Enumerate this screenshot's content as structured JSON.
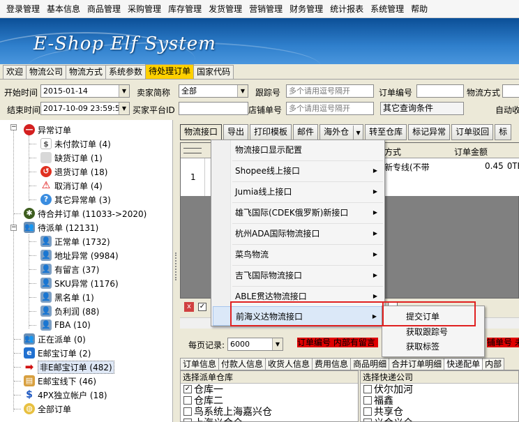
{
  "menubar": [
    "登录管理",
    "基本信息",
    "商品管理",
    "采购管理",
    "库存管理",
    "发货管理",
    "营销管理",
    "财务管理",
    "统计报表",
    "系统管理",
    "帮助"
  ],
  "banner": {
    "title": "E-Shop Elf System"
  },
  "tabs": [
    "欢迎",
    "物流公司",
    "物流方式",
    "系统参数",
    "待处理订单",
    "国家代码"
  ],
  "filters": {
    "start_label": "开始时间",
    "start_value": "2015-01-14",
    "end_label": "结束时间",
    "end_value": "2017-10-09 23:59:5",
    "seller_label": "卖家简称",
    "seller_value": "全部",
    "buyer_label": "买家平台ID",
    "track_label": "跟踪号",
    "track_placeholder": "多个请用逗号隔开",
    "shop_label": "店铺单号",
    "shop_placeholder": "多个请用逗号隔开",
    "order_label": "订单编号",
    "other_label": "其它查询条件",
    "ship_label": "物流方式",
    "auto_label": "自动收"
  },
  "tree": [
    {
      "label": "异常订单",
      "icon": "no-entry-icon"
    },
    {
      "label": "未付款订单 (4)",
      "icon": "dollar-icon"
    },
    {
      "label": "缺货订单 (1)",
      "icon": "box-icon"
    },
    {
      "label": "退货订单 (18)",
      "icon": "return-icon"
    },
    {
      "label": "取消订单 (4)",
      "icon": "warning-icon"
    },
    {
      "label": "其它异常单 (3)",
      "icon": "question-icon"
    },
    {
      "label": "待合并订单 (11033->2020)",
      "icon": "gear-icon"
    },
    {
      "label": "待派单 (12131)",
      "icon": "users-icon"
    },
    {
      "label": "正常单 (1732)",
      "icon": "user-icon"
    },
    {
      "label": "地址异常 (9984)",
      "icon": "user-icon"
    },
    {
      "label": "有留言 (37)",
      "icon": "user-icon"
    },
    {
      "label": "SKU异常 (1176)",
      "icon": "user-icon"
    },
    {
      "label": "黑名单 (1)",
      "icon": "user-icon"
    },
    {
      "label": "负利润 (88)",
      "icon": "user-icon"
    },
    {
      "label": "FBA (10)",
      "icon": "user-icon"
    },
    {
      "label": "正在派单 (0)",
      "icon": "users-icon"
    },
    {
      "label": "E邮宝订单 (2)",
      "icon": "e-icon"
    },
    {
      "label": "非E邮宝订单 (482)",
      "icon": "arrow-icon"
    },
    {
      "label": "E邮宝线下 (46)",
      "icon": "package-icon"
    },
    {
      "label": "4PX独立帐户 (18)",
      "icon": "dollar-icon"
    },
    {
      "label": "全部订单",
      "icon": "globe-icon"
    }
  ],
  "toolbar": [
    "物流接口",
    "导出",
    "打印模板",
    "邮件",
    "海外仓",
    "转至仓库",
    "标记异常",
    "订单驳回",
    "标"
  ],
  "grid": {
    "col_ship": "方式",
    "col_amount": "订单金额",
    "row_num": "1",
    "row_ship": "新专线(不带",
    "row_amount": "0.45",
    "row_tail": "OTE"
  },
  "menu": {
    "items": [
      "物流接口显示配置",
      "Shopee线上接口",
      "Jumia线上接口",
      "雄飞国际(CDEK俄罗斯)新接口",
      "杭州ADA国际物流接口",
      "菜鸟物流",
      "吉飞国际物流接口",
      "ABLE贯达物流接口",
      "前海义达物流接口"
    ],
    "submenu": [
      "提交订单",
      "获取跟踪号",
      "获取标签"
    ]
  },
  "pager": {
    "label": "每页记录:",
    "value": "6000",
    "red_left": "订单编号 内部有留言",
    "red_right": "铺单号 未"
  },
  "bottom_tabs": [
    "订单信息",
    "付款人信息",
    "收货人信息",
    "费用信息",
    "商品明细",
    "合并订单明细",
    "快递配单",
    "内部"
  ],
  "warehouse": {
    "title": "选择派单仓库",
    "items": [
      "仓库一",
      "仓库二",
      "鸟系统上海嘉兴仓",
      "上海义合仓"
    ]
  },
  "courier": {
    "title": "选择快递公司",
    "items": [
      "伏尔加河",
      "福鑫",
      "共享仓",
      "义合义仓"
    ]
  }
}
